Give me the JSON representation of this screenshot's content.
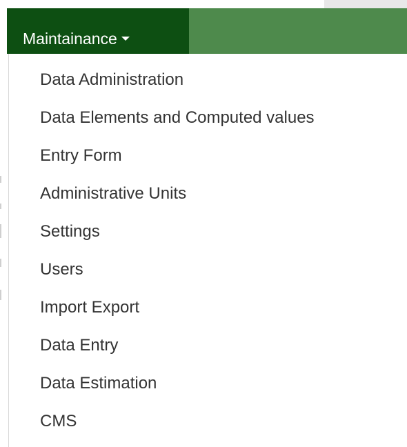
{
  "colors": {
    "navbar_green": "#4e8a4c",
    "active_green": "#0d4f12",
    "menu_text": "#333333"
  },
  "nav": {
    "active_label": "Maintainance",
    "caret_icon": "caret-down-icon"
  },
  "menu": {
    "items": [
      "Data Administration",
      "Data Elements and Computed values",
      "Entry Form",
      "Administrative Units",
      "Settings",
      "Users",
      "Import Export",
      "Data Entry",
      "Data Estimation",
      "CMS"
    ]
  }
}
